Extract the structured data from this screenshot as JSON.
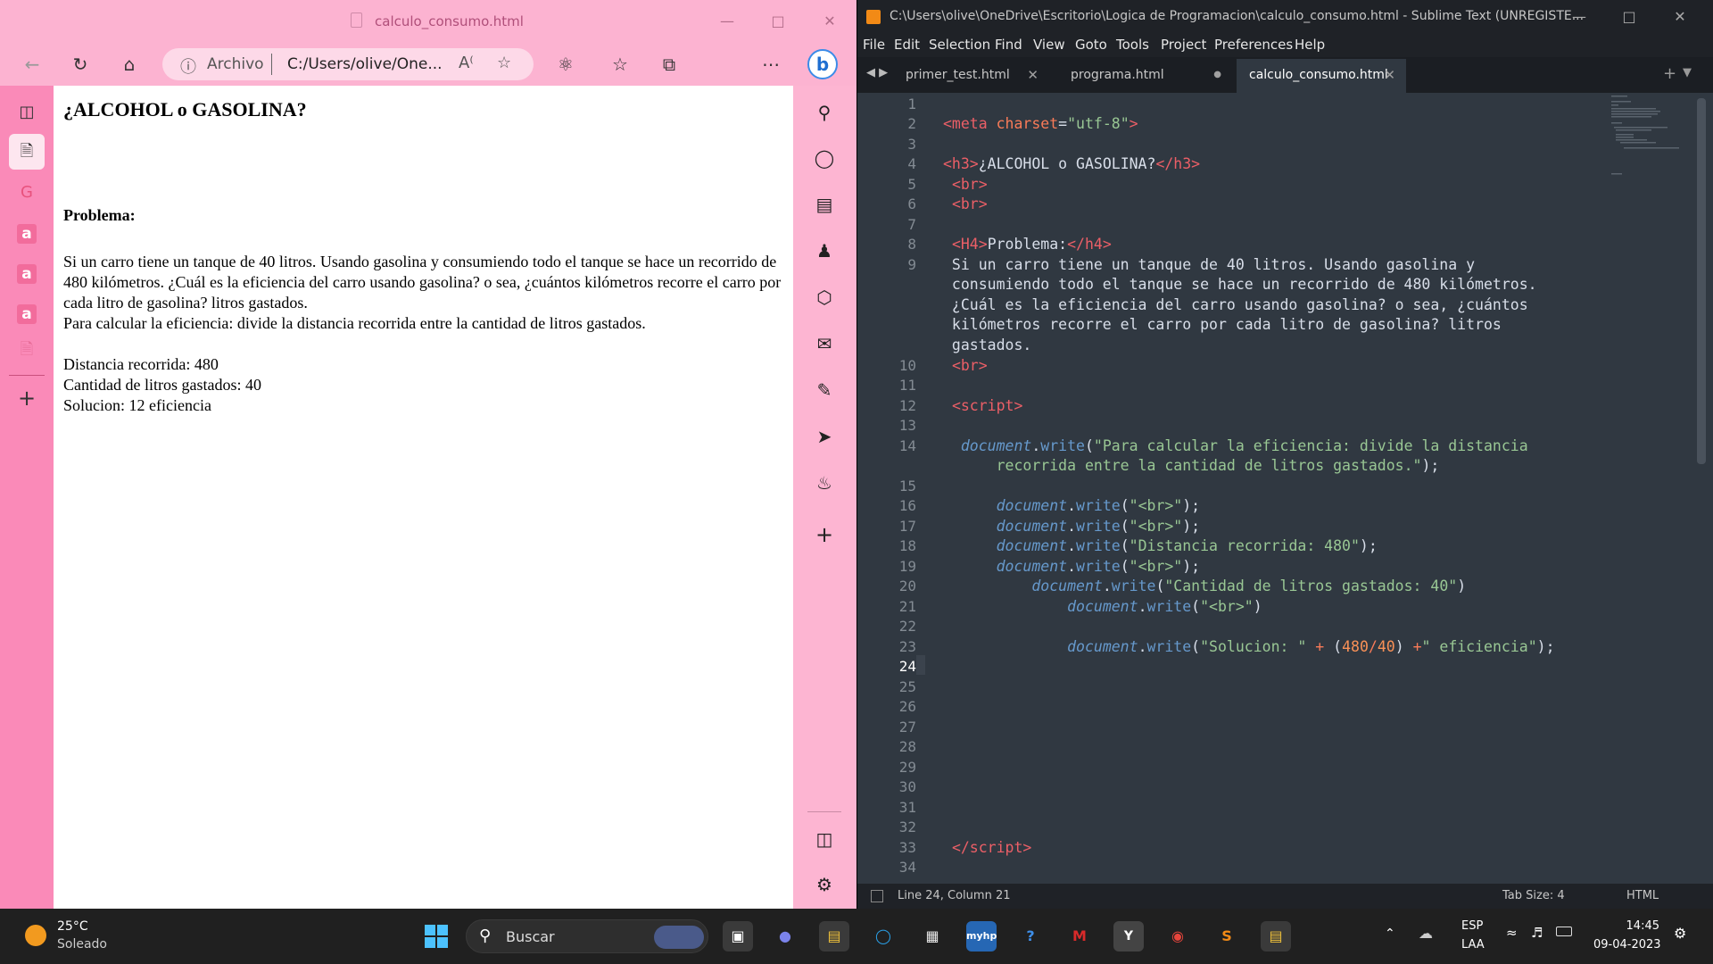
{
  "browser": {
    "tab_title": "calculo_consumo.html",
    "address": {
      "archivo_label": "Archivo",
      "url": "C:/Users/olive/One..."
    },
    "page": {
      "heading": "¿ALCOHOL o GASOLINA?",
      "subheading": "Problema:",
      "paragraph": "Si un carro tiene un tanque de 40 litros. Usando gasolina y consumiendo todo el tanque se hace un recorrido de 480 kilómetros. ¿Cuál es la eficiencia del carro usando gasolina? o sea, ¿cuántos kilómetros recorre el carro por cada litro de gasolina? litros gastados.",
      "instruction": "Para calcular la eficiencia: divide la distancia recorrida entre la cantidad de litros gastados.",
      "distance": "Distancia recorrida: 480",
      "liters": "Cantidad de litros gastados: 40",
      "solution": "Solucion: 12 eficiencia"
    }
  },
  "editor": {
    "title": "C:\\Users\\olive\\OneDrive\\Escritorio\\Logica de Programacion\\calculo_consumo.html - Sublime Text (UNREGISTE...",
    "menu": [
      "File",
      "Edit",
      "Selection",
      "Find",
      "View",
      "Goto",
      "Tools",
      "Project",
      "Preferences",
      "Help"
    ],
    "tabs": [
      "primer_test.html",
      "programa.html",
      "calculo_consumo.html"
    ],
    "status": {
      "position": "Line 24, Column 21",
      "tab_size": "Tab Size: 4",
      "syntax": "HTML"
    }
  },
  "taskbar": {
    "weather_temp": "25°C",
    "weather_desc": "Soleado",
    "search_label": "Buscar",
    "lang": "ESP",
    "lang_sub": "LAA",
    "time": "14:45",
    "date": "09-04-2023"
  },
  "colors": {
    "edge_bg": "#fdb5d2",
    "sublime_bg": "#303841",
    "taskbar": "#202020"
  }
}
